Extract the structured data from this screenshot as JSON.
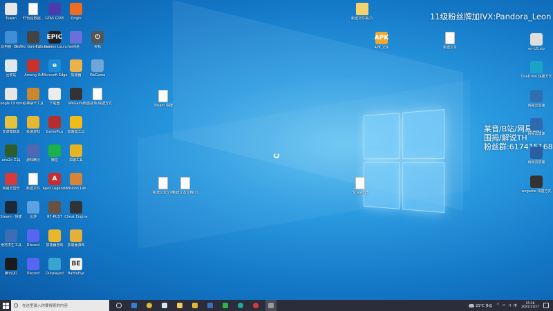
{
  "overlay": {
    "line1": "11级粉丝牌加IVX:Pandora_Leon",
    "line2a": "某音/B站/网易云/",
    "line2b": "围拇/解说TH",
    "line2c": "粉丝群:617415168"
  },
  "icons": [
    {
      "label": "Tuwan",
      "glyph": "",
      "color": "#e7e7e7"
    },
    {
      "label": "ET伪造数据...",
      "glyph": "",
      "color": "#fff",
      "doc": true
    },
    {
      "label": "GTA5 GTA5",
      "glyph": "",
      "color": "#4b3cae"
    },
    {
      "label": "Origin",
      "glyph": "",
      "color": "#f06c20"
    },
    {
      "label": "此电脑 · 快...",
      "glyph": "",
      "color": "#3f8fd6"
    },
    {
      "label": "DeWiki Game Cheater",
      "glyph": "",
      "color": "#444"
    },
    {
      "label": "Epic Games Launcher",
      "glyph": "EPIC",
      "color": "#222"
    },
    {
      "label": "网易",
      "glyph": "",
      "color": "#6a70d8"
    },
    {
      "label": "关机",
      "glyph": "⏻",
      "color": "#555"
    },
    {
      "label": "回收站",
      "glyph": "",
      "color": "#dfe7ef"
    },
    {
      "label": "Among Us",
      "glyph": "",
      "color": "#c8312c"
    },
    {
      "label": "Microsoft Edge",
      "glyph": "e",
      "color": "#1d8bd8"
    },
    {
      "label": "加速器",
      "glyph": "",
      "color": "#ecb24a"
    },
    {
      "label": "WeGame",
      "glyph": "",
      "color": "#6fa5d8"
    },
    {
      "label": "Google Chrome",
      "glyph": "",
      "color": "#e6e6e6"
    },
    {
      "label": "原神抽卡工具",
      "glyph": "",
      "color": "#c9882e"
    },
    {
      "label": "下载器",
      "glyph": "",
      "color": "#ececec"
    },
    {
      "label": "WeGame",
      "glyph": "",
      "color": "#333"
    },
    {
      "label": "刺激战场-快捷方式",
      "glyph": "",
      "color": "#fff",
      "doc": true
    },
    {
      "label": "安卓模拟器",
      "glyph": "",
      "color": "#e5c23b"
    },
    {
      "label": "极速游戏",
      "glyph": "",
      "color": "#e7b733"
    },
    {
      "label": "GamePlus",
      "glyph": "",
      "color": "#b52d2d"
    },
    {
      "label": "加速器工具",
      "glyph": "",
      "color": "#f1bb1c"
    },
    {
      "label": "aria2c 工具",
      "glyph": "",
      "color": "#2e5d2d"
    },
    {
      "label": "游戏精灵",
      "glyph": "",
      "color": "#5067b4"
    },
    {
      "label": "微信",
      "glyph": "",
      "color": "#19b24d"
    },
    {
      "label": "加速工具",
      "glyph": "",
      "color": "#e6b321"
    },
    {
      "label": "网易云音乐",
      "glyph": "",
      "color": "#d73a3a"
    },
    {
      "label": "新建文件",
      "glyph": "",
      "color": "#fff",
      "doc": true
    },
    {
      "label": "Apex Legends",
      "glyph": "A",
      "color": "#c52e2e"
    },
    {
      "label": "Mission Lab",
      "glyph": "",
      "color": "#d7843a"
    },
    {
      "label": "Steam · 快捷",
      "glyph": "",
      "color": "#1b2838"
    },
    {
      "label": "迅游",
      "glyph": "",
      "color": "#5da1e0"
    },
    {
      "label": "R7-RUST",
      "glyph": "",
      "color": "#6a5040"
    },
    {
      "label": "Cheat Engine",
      "glyph": "",
      "color": "#333"
    },
    {
      "label": "绝地求生工具",
      "glyph": "",
      "color": "#3a6fb6"
    },
    {
      "label": "Discord",
      "glyph": "",
      "color": "#5865f2"
    },
    {
      "label": "加速器游戏",
      "glyph": "",
      "color": "#eab62b"
    },
    {
      "label": "加速器游戏",
      "glyph": "",
      "color": "#e4b03a"
    },
    {
      "label": "腾讯QQ",
      "glyph": "",
      "color": "#1b1b1b"
    },
    {
      "label": "Discord",
      "glyph": "",
      "color": "#5865f2"
    },
    {
      "label": "Outplayed",
      "glyph": "",
      "color": "#3aa3d0"
    },
    {
      "label": "BattleEye",
      "glyph": "BE",
      "color": "#f0f0f0"
    },
    {
      "label": "Steam 快捷",
      "glyph": "",
      "color": "#fff",
      "doc": true
    },
    {
      "label": "新建文件夹(2)",
      "glyph": "",
      "color": "#f6d26a",
      "folder": true
    },
    {
      "label": "APK 文件",
      "glyph": "APK",
      "color": "#f0a830"
    },
    {
      "label": "新建文本",
      "glyph": "",
      "color": "#fff",
      "doc": true
    },
    {
      "label": "新建文本文档",
      "glyph": "",
      "color": "#fff",
      "doc": true
    },
    {
      "label": "新建文本文档(2)",
      "glyph": "",
      "color": "#fff",
      "doc": true
    },
    {
      "label": "Scan标记",
      "glyph": "",
      "color": "#fff",
      "doc": true
    },
    {
      "label": "en-US.zip",
      "glyph": "",
      "color": "#ddd"
    },
    {
      "label": "OneDrive 快捷方式",
      "glyph": "",
      "color": "#1aa3c8"
    },
    {
      "label": "网易云加速",
      "glyph": "",
      "color": "#3070b0"
    },
    {
      "label": "网易云加速",
      "glyph": "",
      "color": "#2f6ab0"
    },
    {
      "label": "网易云加速",
      "glyph": "",
      "color": "#2c5fa0"
    },
    {
      "label": "wegame 快捷方式",
      "glyph": "",
      "color": "#333"
    }
  ],
  "taskbar": {
    "search_placeholder": "在这里输入你要搜索的内容",
    "weather": "21°C 多云",
    "time": "15:26",
    "date": "2021/11/27",
    "lang": "中"
  }
}
